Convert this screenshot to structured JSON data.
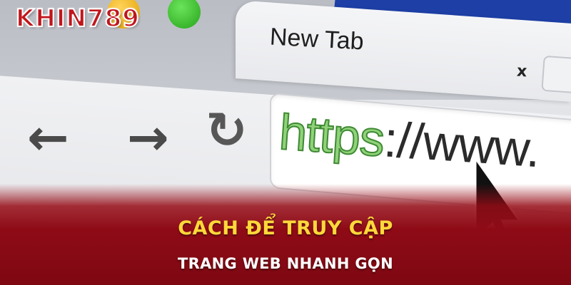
{
  "logo": {
    "text": "KHIN789"
  },
  "browser": {
    "tab_title": "New Tab",
    "tab_close": "x",
    "nav": {
      "back_icon": "arrow-left-icon",
      "forward_icon": "arrow-right-icon",
      "reload_icon": "reload-icon"
    },
    "address_bar": {
      "scheme": "https",
      "rest": "://www."
    }
  },
  "banner": {
    "headline": "CÁCH ĐỂ TRUY CẬP",
    "subline": "TRANG WEB NHANH GỌN"
  },
  "colors": {
    "banner_red": "#8e0b16",
    "headline_yellow": "#ffd83a",
    "url_green": "#8fd27a"
  }
}
